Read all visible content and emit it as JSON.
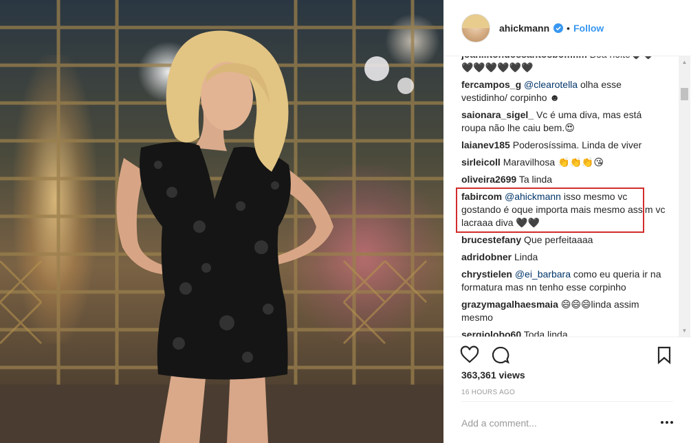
{
  "header": {
    "username": "ahickmann",
    "separator": "•",
    "follow_label": "Follow"
  },
  "comments": [
    {
      "user": "joanilitondossantosbomfim",
      "mention": "",
      "text": "Boa noite🖤🖤 🖤🖤🖤🖤🖤🖤"
    },
    {
      "user": "fercampos_g",
      "mention": "@clearotella",
      "text": "olha esse vestidinho/ corpinho ☻"
    },
    {
      "user": "saionara_sigel_",
      "mention": "",
      "text": "Vc é uma diva, mas está roupa não lhe caiu bem.😍"
    },
    {
      "user": "laianev185",
      "mention": "",
      "text": "Poderosíssima. Linda de viver"
    },
    {
      "user": "sirleicoll",
      "mention": "",
      "text": "Maravilhosa 👏👏👏😘"
    },
    {
      "user": "oliveira2699",
      "mention": "",
      "text": "Ta linda"
    },
    {
      "user": "fabircom",
      "mention": "@ahickmann",
      "text": "isso mesmo vc gostando é oque importa mais mesmo assim vc lacraaa diva 🖤🖤"
    },
    {
      "user": "brucestefany",
      "mention": "",
      "text": "Que perfeitaaaa"
    },
    {
      "user": "adridobner",
      "mention": "",
      "text": "Linda"
    },
    {
      "user": "chrystielen",
      "mention": "@ei_barbara",
      "text": "como eu queria ir na formatura mas nn tenho esse corpinho"
    },
    {
      "user": "grazymagalhaesmaia",
      "mention": "",
      "text": "😄😄😄linda assim mesmo"
    },
    {
      "user": "sergiolobo60",
      "mention": "",
      "text": "Toda linda"
    }
  ],
  "stats": {
    "views": "363,361 views",
    "time_ago": "16 HOURS AGO"
  },
  "comment_box": {
    "placeholder": "Add a comment..."
  },
  "icons": {
    "like": "heart-icon",
    "comment": "comment-bubble-icon",
    "save": "bookmark-icon",
    "more": "more-dots-icon",
    "verified": "verified-badge-icon"
  },
  "colors": {
    "link": "#3897f0",
    "mention": "#003569",
    "highlight": "#d22b2b",
    "text": "#262626",
    "muted": "#999999"
  }
}
